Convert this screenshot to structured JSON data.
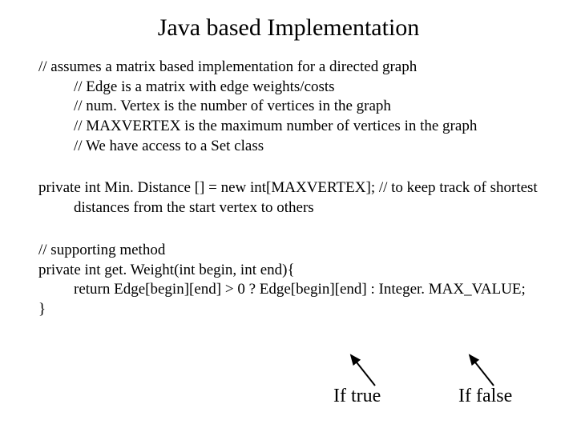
{
  "title": "Java based Implementation",
  "c1": "// assumes a matrix based implementation for a directed graph",
  "c2": "// Edge is a matrix with edge weights/costs",
  "c3": "// num. Vertex is the number of vertices in the graph",
  "c4": "// MAXVERTEX is the maximum number of vertices in the graph",
  "c5": "// We have access to a Set class",
  "p1": "private int Min. Distance [] = new int[MAXVERTEX]; // to keep track of shortest distances from the start vertex to others",
  "m1": "// supporting method",
  "m2": "private int get. Weight(int begin, int end){",
  "m3": "return Edge[begin][end] > 0 ? Edge[begin][end] : Integer. MAX_VALUE;",
  "m4": "}",
  "labelTrue": "If true",
  "labelFalse": "If false"
}
